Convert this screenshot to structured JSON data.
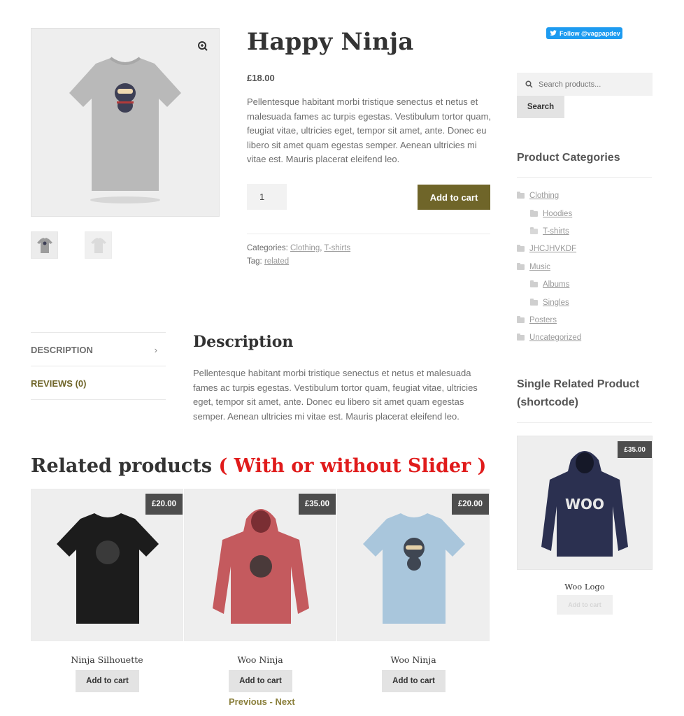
{
  "product": {
    "title": "Happy Ninja",
    "price": "£18.00",
    "description": "Pellentesque habitant morbi tristique senectus et netus et malesuada fames ac turpis egestas. Vestibulum tortor quam, feugiat vitae, ultricies eget, tempor sit amet, ante. Donec eu libero sit amet quam egestas semper. Aenean ultricies mi vitae est. Mauris placerat eleifend leo.",
    "quantity": "1",
    "add_to_cart_label": "Add to cart",
    "categories_label": "Categories:",
    "categories": [
      "Clothing",
      "T-shirts"
    ],
    "tag_label": "Tag:",
    "tag": "related"
  },
  "tabs": [
    {
      "label": "DESCRIPTION",
      "active": true
    },
    {
      "label": "REVIEWS (0)",
      "active": false
    }
  ],
  "description_panel": {
    "heading": "Description",
    "body": "Pellentesque habitant morbi tristique senectus et netus et malesuada fames ac turpis egestas. Vestibulum tortor quam, feugiat vitae, ultricies eget, tempor sit amet, ante. Donec eu libero sit amet quam egestas semper. Aenean ultricies mi vitae est. Mauris placerat eleifend leo."
  },
  "related": {
    "heading": "Related products",
    "heading_note": "( With or without Slider )",
    "items": [
      {
        "name": "Ninja Silhouette",
        "price": "£20.00",
        "button": "Add to cart",
        "color": "#1c1c1c",
        "kind": "tshirt"
      },
      {
        "name": "Woo Ninja",
        "price": "£35.00",
        "button": "Add to cart",
        "color": "#c45a5e",
        "kind": "hoodie"
      },
      {
        "name": "Woo Ninja",
        "price": "£20.00",
        "button": "Add to cart",
        "color": "#a9c6dc",
        "kind": "tshirt"
      }
    ],
    "pager_prev": "Previous",
    "pager_sep": " - ",
    "pager_next": "Next"
  },
  "sidebar": {
    "follow_label": "Follow @vagpapdev",
    "search_placeholder": "Search products...",
    "search_button": "Search",
    "categories_heading": "Product Categories",
    "categories": [
      {
        "label": "Clothing",
        "level": 0
      },
      {
        "label": "Hoodies",
        "level": 1
      },
      {
        "label": "T-shirts",
        "level": 1
      },
      {
        "label": "JHCJHVKDF",
        "level": 0
      },
      {
        "label": "Music",
        "level": 0
      },
      {
        "label": "Albums",
        "level": 1
      },
      {
        "label": "Singles",
        "level": 1
      },
      {
        "label": "Posters",
        "level": 0
      },
      {
        "label": "Uncategorized",
        "level": 0
      }
    ],
    "single_heading": "Single Related Product (shortcode)",
    "single_product": {
      "name": "Woo Logo",
      "price": "£35.00",
      "button": "Add to cart",
      "color": "#2b3050",
      "logo_text": "WOO"
    }
  },
  "colors": {
    "accent": "#6f6529",
    "badge": "#4d4d4d",
    "highlight_red": "#e01b1b",
    "twitter": "#1d9bf0"
  },
  "icons": [
    "zoom-icon",
    "chevron-right-icon",
    "search-icon",
    "twitter-bird-icon",
    "folder-icon"
  ]
}
